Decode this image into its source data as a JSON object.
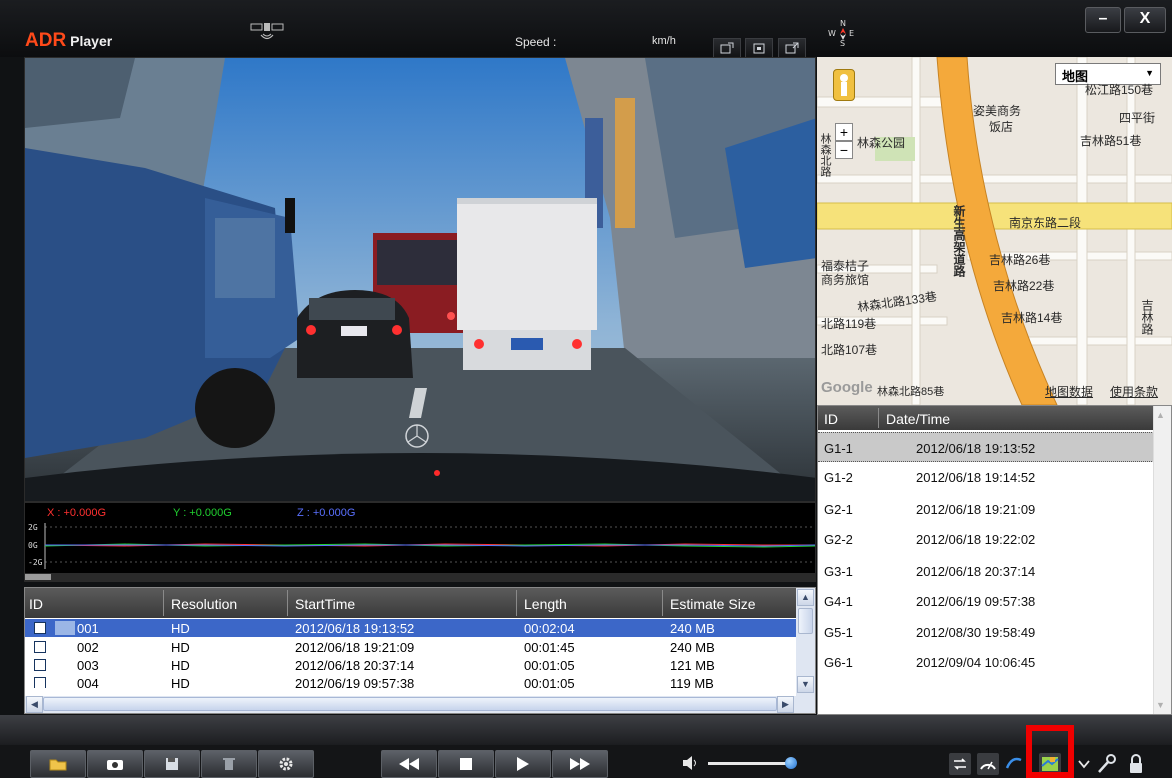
{
  "app": {
    "brand_main": "ADR",
    "brand_sub": "Player"
  },
  "titlebar": {
    "speed_label": "Speed :",
    "speed_unit": "km/h",
    "compass_icon": "compass-icon",
    "gps_signal_icon": "gps-satellite-icon",
    "minimize_label": "–",
    "close_label": "X"
  },
  "gsensor": {
    "x_label": "X : +0.000G",
    "y_label": "Y : +0.000G",
    "z_label": "Z : +0.000G",
    "ticks": [
      "2G",
      "0G",
      "-2G"
    ],
    "colors": {
      "x": "#ff3030",
      "y": "#20d030",
      "z": "#4060ff"
    }
  },
  "clips": {
    "headers": [
      "ID",
      "Resolution",
      "StartTime",
      "Length",
      "Estimate Size"
    ],
    "rows": [
      {
        "id": "001",
        "resolution": "HD",
        "start": "2012/06/18 19:13:52",
        "length": "00:02:04",
        "size": "240 MB"
      },
      {
        "id": "002",
        "resolution": "HD",
        "start": "2012/06/18 19:21:09",
        "length": "00:01:45",
        "size": "240 MB"
      },
      {
        "id": "003",
        "resolution": "HD",
        "start": "2012/06/18 20:37:14",
        "length": "00:01:05",
        "size": "121 MB"
      },
      {
        "id": "004",
        "resolution": "HD",
        "start": "2012/06/19 09:57:38",
        "length": "00:01:05",
        "size": "119 MB"
      }
    ]
  },
  "map": {
    "map_type": "地图",
    "labels": {
      "songjiang": "松江路150巷",
      "siping": "四平街",
      "zimei": "姿美商务",
      "fandian": "饭店",
      "jilin51": "吉林路51巷",
      "linsen_park": "林森公园",
      "nanjing": "南京东路二段",
      "xinsheng": "新生高架道路",
      "jilin26": "吉林路26巷",
      "jilin22": "吉林路22巷",
      "jilin14": "吉林路14巷",
      "jilin_road": "吉林路",
      "futai": "福泰桔子",
      "shangwu": "商务旅馆",
      "linsen133": "林森北路133巷",
      "north119": "北路119巷",
      "north107": "北路107巷",
      "north85": "林森北路85巷",
      "map_data": "地图数据",
      "terms": "使用条款",
      "google": "Google",
      "left_edge": "林森北路"
    }
  },
  "gps": {
    "headers": [
      "ID",
      "Date/Time"
    ],
    "rows": [
      {
        "id": "G1-1",
        "time": "2012/06/18  19:13:52"
      },
      {
        "id": "G1-2",
        "time": "2012/06/18  19:14:52"
      },
      {
        "id": "G2-1",
        "time": "2012/06/18  19:21:09"
      },
      {
        "id": "G2-2",
        "time": "2012/06/18  19:22:02"
      },
      {
        "id": "G3-1",
        "time": "2012/06/18  20:37:14"
      },
      {
        "id": "G4-1",
        "time": "2012/06/19  09:57:38"
      },
      {
        "id": "G5-1",
        "time": "2012/08/30  19:58:49"
      },
      {
        "id": "G6-1",
        "time": "2012/09/04  10:06:45"
      }
    ]
  },
  "controls": {
    "left": [
      "folder-icon",
      "camera-icon",
      "save-icon",
      "trash-icon",
      "gear-icon"
    ],
    "playback": [
      "rewind-icon",
      "stop-icon",
      "play-icon",
      "fast-forward-icon"
    ],
    "volume_level": 0.9,
    "right": [
      "repeat-icon",
      "speed-icon",
      "arrow-icon",
      "map-icon",
      "dropdown-icon",
      "key-icon",
      "lock-icon"
    ]
  }
}
